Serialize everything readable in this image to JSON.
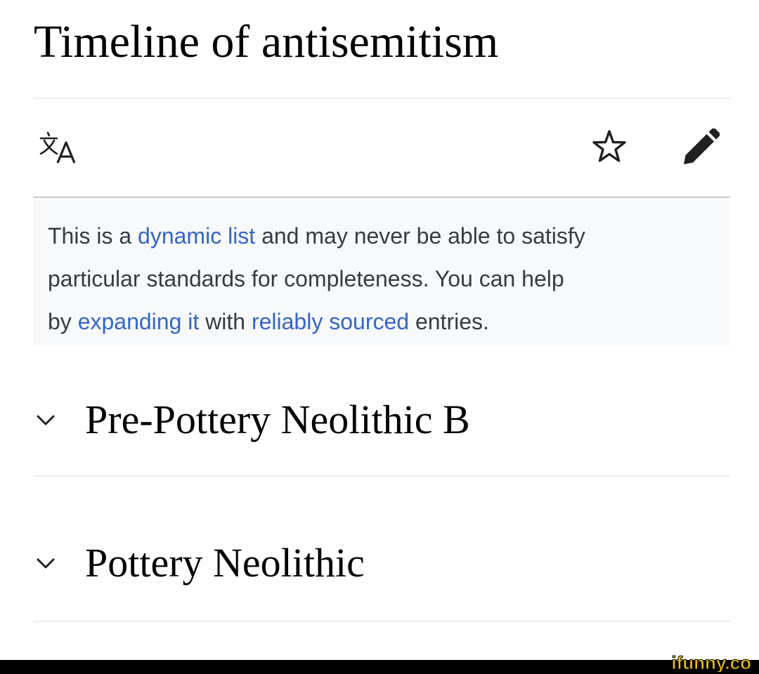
{
  "page": {
    "title": "Timeline of antisemitism"
  },
  "toolbar": {
    "language_icon": "translate-icon",
    "watch_icon": "star-icon",
    "edit_icon": "pencil-icon"
  },
  "notice": {
    "parts": [
      "This is a ",
      "dynamic list",
      " and may never be able to satisfy",
      "particular standards for completeness. You can help",
      "by ",
      "expanding it",
      " with ",
      "reliably sourced",
      " entries."
    ]
  },
  "sections": [
    {
      "title": "Pre-Pottery Neolithic B",
      "icon": "chevron-down-icon"
    },
    {
      "title": "Pottery Neolithic",
      "icon": "chevron-down-icon"
    }
  ],
  "watermark": {
    "text": "ifunny.co"
  },
  "colors": {
    "link": "#3366cc",
    "notice_background": "#f8f9fa",
    "divider": "#eaecf0",
    "watermark": "#f5c400"
  }
}
